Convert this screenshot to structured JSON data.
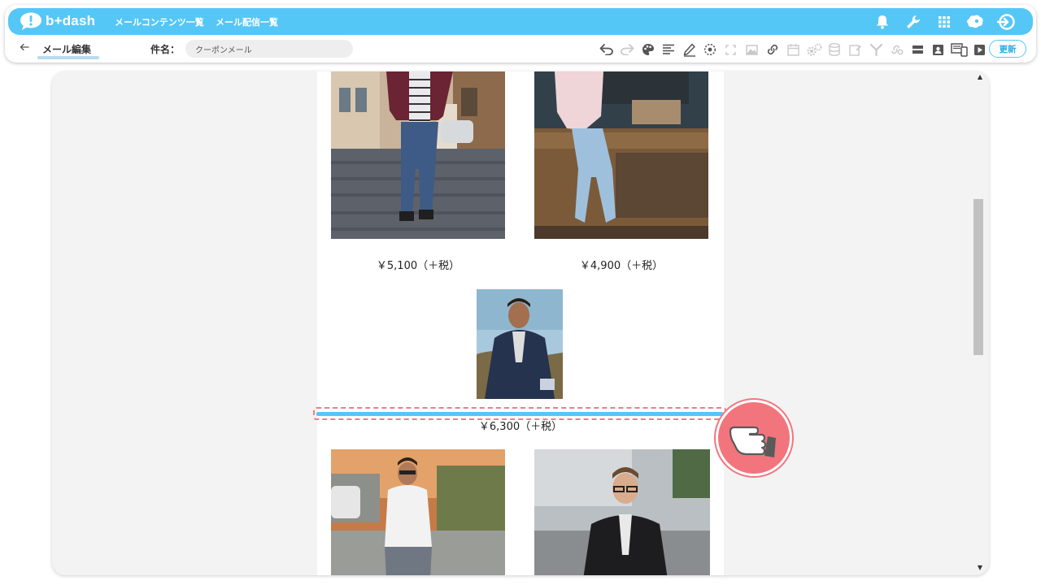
{
  "app": {
    "brand": "b+dash",
    "nav": [
      {
        "label": "メールコンテンツ一覧"
      },
      {
        "label": "メール配信一覧"
      }
    ],
    "top_icons": [
      "bell-icon",
      "wrench-icon",
      "apps-grid-icon",
      "brain-icon",
      "logout-icon"
    ],
    "accent_color": "#55c7f6"
  },
  "editor": {
    "tab_label": "メール編集",
    "subject_label": "件名：",
    "subject_value": "クーポンメール",
    "update_label": "更新",
    "tools": [
      {
        "icon": "undo-icon",
        "enabled": true
      },
      {
        "icon": "redo-icon",
        "enabled": false
      },
      {
        "icon": "palette-icon",
        "enabled": true
      },
      {
        "icon": "align-left-icon",
        "enabled": true
      },
      {
        "icon": "pen-icon",
        "enabled": true
      },
      {
        "icon": "target-icon",
        "enabled": true
      },
      {
        "icon": "fullscreen-icon",
        "enabled": false
      },
      {
        "icon": "image-icon",
        "enabled": false
      },
      {
        "icon": "link-icon",
        "enabled": true
      },
      {
        "icon": "calendar-icon",
        "enabled": false
      },
      {
        "icon": "gears-icon",
        "enabled": false
      },
      {
        "icon": "database-icon",
        "enabled": false
      },
      {
        "icon": "note-edit-icon",
        "enabled": false
      },
      {
        "icon": "filter-icon",
        "enabled": false
      },
      {
        "icon": "chain-settings-icon",
        "enabled": false
      },
      {
        "icon": "divider-block-icon",
        "enabled": true
      },
      {
        "icon": "contact-card-icon",
        "enabled": true
      },
      {
        "icon": "device-preview-icon",
        "enabled": true
      },
      {
        "icon": "play-icon",
        "enabled": true
      }
    ]
  },
  "email": {
    "prices": [
      {
        "label": "￥5,100（＋税）"
      },
      {
        "label": "￥4,900（＋税）"
      },
      {
        "label": "￥6,300（＋税）"
      }
    ]
  },
  "drop_indicator_color": "#ef7d86"
}
